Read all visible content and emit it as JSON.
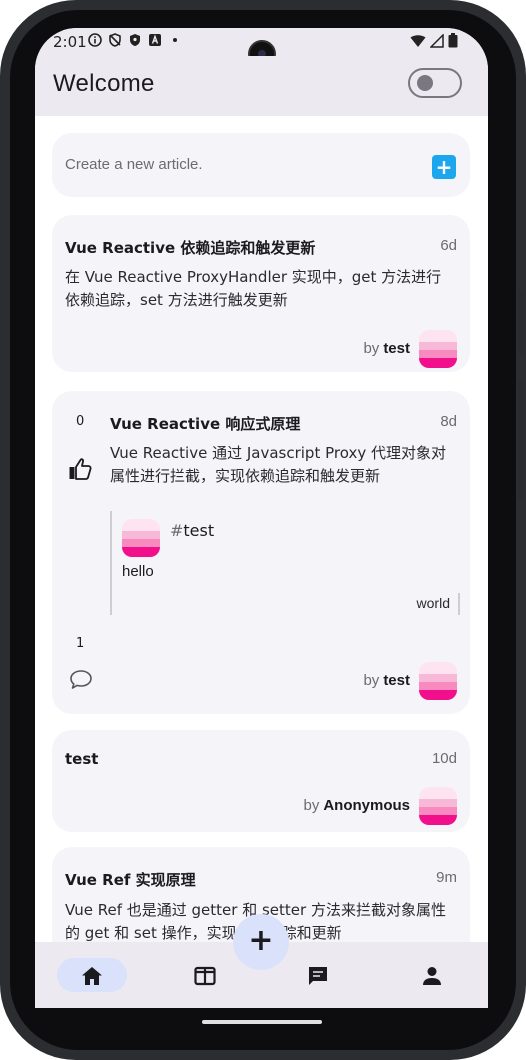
{
  "status_bar": {
    "time": "2:01"
  },
  "app_bar": {
    "title": "Welcome"
  },
  "create_card": {
    "placeholder": "Create a new article.",
    "add_label": "+"
  },
  "articles": [
    {
      "title": "Vue Reactive 依赖追踪和触发更新",
      "age": "6d",
      "body_lines": [
        "在 Vue Reactive ProxyHandler 实现中，get 方法进行",
        "依赖追踪，set 方法进行触发更新"
      ],
      "by": "by",
      "author": "test"
    },
    {
      "title": "Vue Reactive 响应式原理",
      "age": "8d",
      "body_lines": [
        "Vue Reactive 通过 Javascript Proxy  代理对象对",
        "属性进行拦截，实现依赖追踪和触发更新"
      ],
      "like_count": "0",
      "comment_count": "1",
      "comment": {
        "hash": "#",
        "tag": "test",
        "text": "hello",
        "reply": "world"
      },
      "by": "by",
      "author": "test"
    },
    {
      "title": "test",
      "age": "10d",
      "by": "by",
      "author": "Anonymous"
    },
    {
      "title": "Vue Ref 实现原理",
      "age": "9m",
      "body_lines": [
        "Vue Ref 也是通过 getter 和 setter 方法来拦截对象属性",
        "的 get 和 set 操作，实现依赖追踪和更新"
      ]
    }
  ],
  "fab": {
    "label": "+"
  },
  "bottom_nav": [
    "home-icon",
    "columns-icon",
    "chat-icon",
    "person-icon"
  ],
  "colors": {
    "accent": "#1ba6ee",
    "nav_active": "#d9e1fb",
    "surface": "#f5f4f8",
    "appbar": "#ece9f0"
  }
}
